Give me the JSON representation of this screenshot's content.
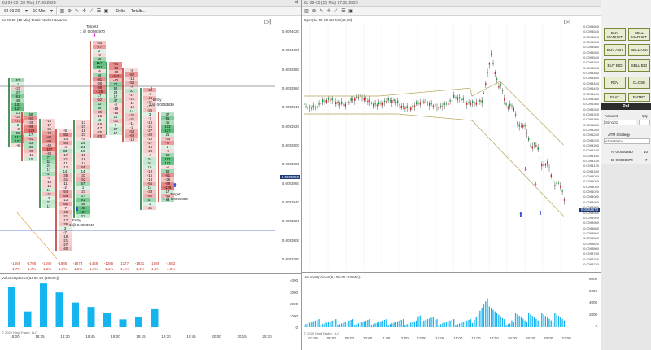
{
  "left_window": {
    "title": "6J 09-20 (10 Min)  27.08.2020",
    "toolbar": {
      "instrument": "6J 09-20",
      "interval": "10 Min",
      "delta_label": "Delta",
      "totals_label": "Totalb..."
    },
    "chart_label": "6J 09-20 (10 Min) Trade Market Balance",
    "price_axis": [
      "0.0094020",
      "0.0094000",
      "0.0093980",
      "0.0093960",
      "0.0093940",
      "0.0093920",
      "0.0093900",
      "0.0093880",
      "0.0093860",
      "0.0093840",
      "0.0093820",
      "0.0093800",
      "0.0093780"
    ],
    "last_price": "0.0093860",
    "annotations": {
      "target_top": "Target1",
      "target_top_qty": "1 @ 0.0093970",
      "entry_left": "Entry",
      "entry_left_qty": "1 @ 0.0093940",
      "entry_right": "Entry",
      "entry_right_qty": "1 @ 0.0093930",
      "target_bottom": "Target1",
      "target_bottom_qty": "1 @ 0.0093880"
    },
    "delta_values": [
      "-1669",
      "-1705",
      "-1590",
      "-1886",
      "-1673",
      "-1469",
      "-1285",
      "-1177",
      "-1631",
      "-1888",
      "-1653"
    ],
    "delta_pct": [
      "-1,7%",
      "-1,7%",
      "-1,5%",
      "-1,8%",
      "-1,5%",
      "-1,3%",
      "-1,1%",
      "-1,4%",
      "-1,4%",
      "-1,8%",
      "-1,6%"
    ],
    "volume_label": "VolumeUpDown(6J 09-20 (10 Min))",
    "volume_axis": [
      "4000",
      "3000",
      "2000",
      "1000",
      "0"
    ],
    "time_axis": [
      "18:00",
      "18:15",
      "18:30",
      "18:45",
      "19:00",
      "19:15",
      "19:30",
      "19:45",
      "20:00",
      "20:15",
      "20:30"
    ],
    "copyright": "© 2020 NinjaTrader, LLC",
    "footprint_visible_numbers": [
      "57",
      "1",
      "-21",
      "37",
      "91",
      "45",
      "103",
      "127",
      "21",
      "-34",
      "-77",
      "2",
      "-8",
      "58",
      "117",
      "107",
      "-6",
      "58",
      "-91",
      "-36",
      "-99",
      "-128",
      "17",
      "-52",
      "43",
      "36",
      "-39",
      "-13",
      "15",
      "-16",
      "-17",
      "-25",
      "-70",
      "-94",
      "-93",
      "-40",
      "-167",
      "-43",
      "77",
      "52",
      "24",
      "17",
      "47",
      "-8",
      "-18",
      "-15",
      "14",
      "-31",
      "3",
      "27",
      "17",
      "-8",
      "-82",
      "-14",
      "-54",
      "-4",
      "33",
      "-17",
      "-21",
      "-11",
      "-12",
      "14",
      "-35",
      "-31",
      "-11",
      "-2",
      "-54",
      "-69",
      "-13",
      "-60",
      "-7",
      "-46",
      "-21",
      "-17",
      "-35",
      "3",
      "-7",
      "-18",
      "-21",
      "-27",
      "-40",
      "-13",
      "-27",
      "-19",
      "-23",
      "-4",
      "24",
      "24",
      "10",
      "-19",
      "-16",
      "-14",
      "-55",
      "14",
      "-33",
      "-52"
    ]
  },
  "right_window": {
    "title": "6J 09-20 (10 Min)  27.08.2020",
    "chart_label": "Open(6J 09-20 (10 Min),2,20)",
    "price_axis": [
      "0.0094660",
      "0.0094640",
      "0.0094620",
      "0.0094600",
      "0.0094580",
      "0.0094560",
      "0.0094540",
      "0.0094520",
      "0.0094500",
      "0.0094480",
      "0.0094460",
      "0.0094440",
      "0.0094420",
      "0.0094400",
      "0.0094380",
      "0.0094360",
      "0.0094340",
      "0.0094320",
      "0.0094300",
      "0.0094280",
      "0.0094260",
      "0.0094240",
      "0.0094220",
      "0.0094200",
      "0.0094180",
      "0.0094160",
      "0.0094140",
      "0.0094120",
      "0.0094100",
      "0.0094080",
      "0.0094060",
      "0.0094040",
      "0.0094020",
      "0.0094000",
      "0.0093980",
      "0.0093960",
      "0.0093940",
      "0.0093920",
      "0.0093900",
      "0.0093880",
      "0.0093860",
      "0.0093840",
      "0.0093820",
      "0.0093800",
      "0.0093780",
      "0.0093760",
      "0.0093740"
    ],
    "last_price": "0.0093870",
    "volume_label": "VolumeUpDown(6J 09-20 (10 Min))",
    "volume_axis": [
      "8000",
      "6000",
      "4000",
      "2000",
      "0"
    ],
    "time_axis": [
      "07:00",
      "08:00",
      "09:00",
      "10:00",
      "11:00",
      "12:00",
      "13:00",
      "14:00",
      "15:00",
      "16:00",
      "17:00",
      "18:00",
      "19:00",
      "20:00",
      "21:00"
    ],
    "copyright": "© 2020 NinjaTrader, LLC"
  },
  "trade_panel": {
    "buttons": [
      "BUY MARKET",
      "SELL MARKET",
      "BUY ASK",
      "SELL ASK",
      "BUY BID",
      "SELL BID",
      "REV",
      "CLOSE",
      "FLAT",
      "ENTRY"
    ],
    "pnl_label": "PnL",
    "account_label": "Account",
    "qty_label": "Qty",
    "account_value": "Sim101",
    "atm_label": "ATM Strategy",
    "atm_value": "<Custom>",
    "a_label": "A: 0.0093880",
    "a_qty": "10",
    "b_label": "B: 0.0093870",
    "b_qty": "7"
  }
}
